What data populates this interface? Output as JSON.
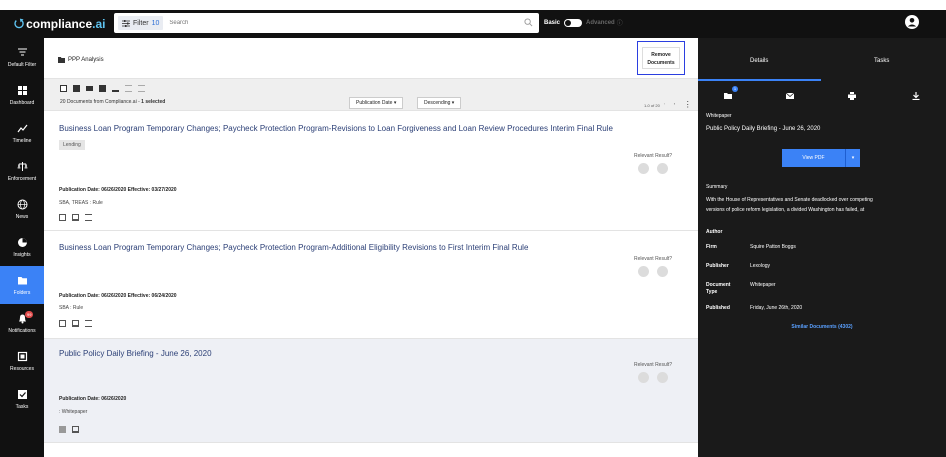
{
  "app": {
    "logo_text": "compliance",
    "logo_suffix": ".ai",
    "filter_label": "Filter",
    "filter_count": "10",
    "search_placeholder": "Search",
    "mode_basic": "Basic",
    "mode_advanced": "Advanced"
  },
  "sidebar": {
    "items": [
      {
        "label": "Default Filter",
        "icon": "filter-icon"
      },
      {
        "label": "Dashboard",
        "icon": "dashboard-icon"
      },
      {
        "label": "Timeline",
        "icon": "timeline-icon"
      },
      {
        "label": "Enforcement",
        "icon": "enforcement-icon"
      },
      {
        "label": "News",
        "icon": "globe-icon"
      },
      {
        "label": "Insights",
        "icon": "insights-icon"
      },
      {
        "label": "Folders",
        "icon": "folder-icon"
      },
      {
        "label": "Notifications",
        "icon": "bell-icon",
        "badge": "99"
      },
      {
        "label": "Resources",
        "icon": "resources-icon"
      },
      {
        "label": "Tasks",
        "icon": "tasks-icon"
      }
    ]
  },
  "folder": {
    "name": "PPP Analysis",
    "remove_line1": "Remove",
    "remove_line2": "Documents"
  },
  "toolbar": {
    "count_text": "20 Documents from Compliance.ai - ",
    "selected_text": "1 selected",
    "sort_field": "Publication Date",
    "sort_order": "Descending",
    "pager": "1-0 of 20"
  },
  "documents": [
    {
      "title": "Business Loan Program Temporary Changes; Paycheck Protection Program-Revisions to Loan Forgiveness and Loan Review Procedures Interim Final Rule",
      "tag": "Lending",
      "relevant": "Relevant Result?",
      "pub": "Publication Date: 06/26/2020 Effective: 03/27/2020",
      "agency": "SBA, TREAS : Rule"
    },
    {
      "title": "Business Loan Program Temporary Changes; Paycheck Protection Program-Additional Eligibility Revisions to First Interim Final Rule",
      "relevant": "Relevant Result?",
      "pub": "Publication Date: 06/26/2020 Effective: 06/24/2020",
      "agency": "SBA : Rule"
    },
    {
      "title": "Public Policy Daily Briefing - June 26, 2020",
      "relevant": "Relevant Result?",
      "pub": "Publication Date: 06/26/2020",
      "agency": ": Whitepaper"
    }
  ],
  "panel": {
    "tab_details": "Details",
    "tab_tasks": "Tasks",
    "folder_badge": "1",
    "doc_type": "Whitepaper",
    "doc_title": "Public Policy Daily Briefing - June 26, 2020",
    "view_pdf": "View PDF",
    "summary_label": "Summary",
    "summary_line1": "With the House of Representatives and Senate deadlocked over competing",
    "summary_line2": "versions of police reform legislation, a divided Washington has failed, at",
    "author_label": "Author",
    "firm_label": "Firm",
    "firm_value": "Squire Patton Boggs",
    "publisher_label": "Publisher",
    "publisher_value": "Lexology",
    "doctype_label": "Document Type",
    "doctype_value": "Whitepaper",
    "published_label": "Published",
    "published_value": "Friday, June 26th, 2020",
    "similar": "Similar Documents (4302)"
  },
  "colors": {
    "accent": "#3b82f6",
    "dark": "#111111",
    "title_link": "#2b3f76",
    "highlight_box": "#2b3fe0"
  }
}
